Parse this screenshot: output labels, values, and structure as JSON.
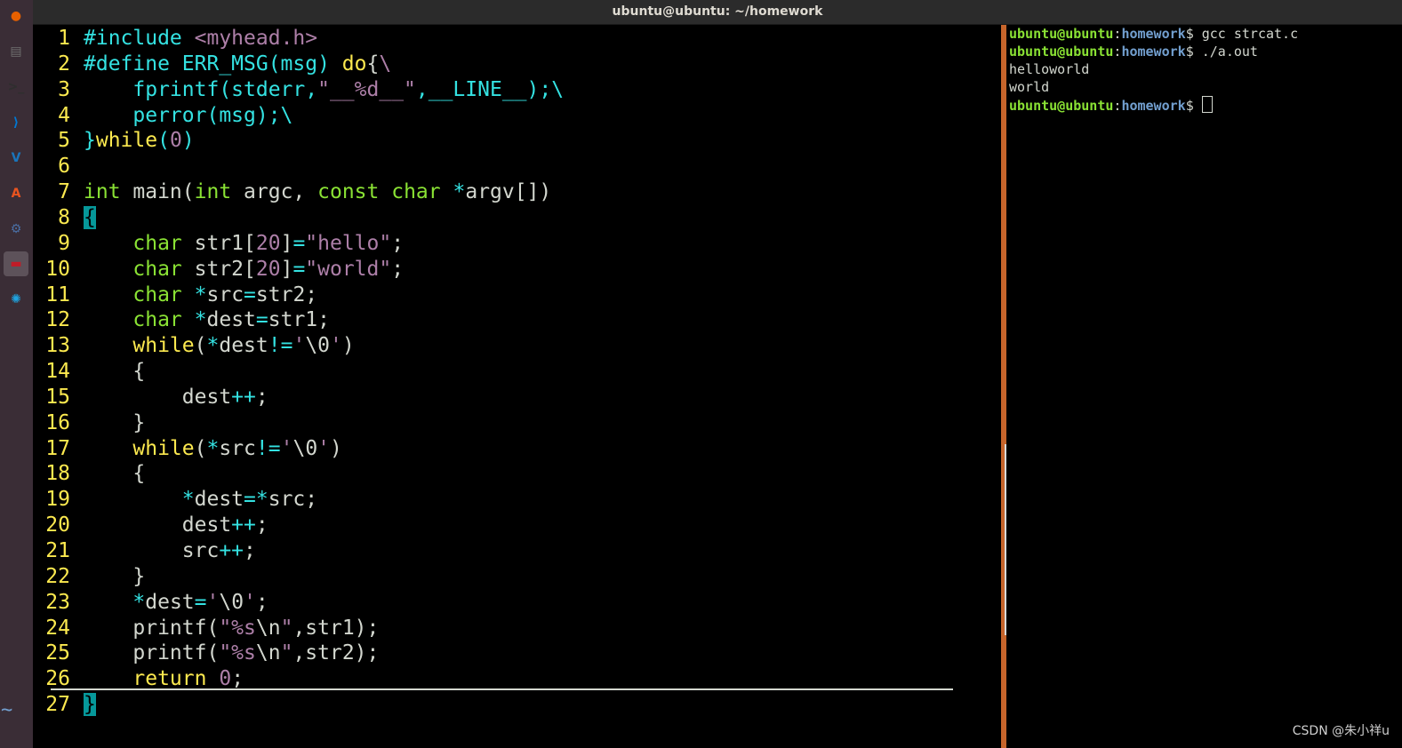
{
  "window": {
    "title": "ubuntu@ubuntu: ~/homework"
  },
  "launcher": {
    "items": [
      {
        "name": "firefox",
        "glyph": "●",
        "color": "#e66000"
      },
      {
        "name": "files",
        "glyph": "▤",
        "color": "#6f6f6f"
      },
      {
        "name": "terminal",
        "glyph": ">_",
        "color": "#2e2e2e"
      },
      {
        "name": "vscode",
        "glyph": "⟩",
        "color": "#0078d4"
      },
      {
        "name": "vmware",
        "glyph": "V",
        "color": "#1a75bb"
      },
      {
        "name": "software",
        "glyph": "A",
        "color": "#e95420"
      },
      {
        "name": "network",
        "glyph": "⚙",
        "color": "#4a6fa5"
      },
      {
        "name": "terminal-active",
        "glyph": "▬",
        "color": "#c01c28"
      },
      {
        "name": "settings",
        "glyph": "✺",
        "color": "#1fa3e0"
      }
    ]
  },
  "editor": {
    "lines": [
      {
        "n": "1",
        "html": "<span class='pp'>#include</span> <span class='str'>&lt;myhead.h&gt;</span>"
      },
      {
        "n": "2",
        "html": "<span class='pp'>#define ERR_MSG(msg) </span><span class='kw'>do</span>{<span class='str'>\\</span>"
      },
      {
        "n": "3",
        "html": "    <span class='pp'>fprintf(stderr,</span><span class='str'>\"__%d__\"</span><span class='pp'>,__LINE__);\\</span>"
      },
      {
        "n": "4",
        "html": "    <span class='pp'>perror(msg);\\</span>"
      },
      {
        "n": "5",
        "html": "<span class='pp'>}</span><span class='kw'>while</span><span class='pp'>(</span><span class='num'>0</span><span class='pp'>)</span>"
      },
      {
        "n": "6",
        "html": ""
      },
      {
        "n": "7",
        "html": "<span class='ty'>int</span> main(<span class='ty'>int</span> argc, <span class='ty'>const</span> <span class='ty'>char</span> <span class='op'>*</span>argv[])"
      },
      {
        "n": "8",
        "html": "<span class='cursor'>{</span>"
      },
      {
        "n": "9",
        "html": "    <span class='ty'>char</span> str1[<span class='num'>20</span>]<span class='op'>=</span><span class='str'>\"hello\"</span>;"
      },
      {
        "n": "10",
        "html": "    <span class='ty'>char</span> str2[<span class='num'>20</span>]<span class='op'>=</span><span class='str'>\"world\"</span>;"
      },
      {
        "n": "11",
        "html": "    <span class='ty'>char</span> <span class='op'>*</span>src<span class='op'>=</span>str2;"
      },
      {
        "n": "12",
        "html": "    <span class='ty'>char</span> <span class='op'>*</span>dest<span class='op'>=</span>str1;"
      },
      {
        "n": "13",
        "html": "    <span class='kw'>while</span>(<span class='op'>*</span>dest<span class='op'>!=</span><span class='str'>'</span>\\0<span class='str'>'</span>)"
      },
      {
        "n": "14",
        "html": "    {"
      },
      {
        "n": "15",
        "html": "        dest<span class='op'>++</span>;"
      },
      {
        "n": "16",
        "html": "    }"
      },
      {
        "n": "17",
        "html": "    <span class='kw'>while</span>(<span class='op'>*</span>src<span class='op'>!=</span><span class='str'>'</span>\\0<span class='str'>'</span>)"
      },
      {
        "n": "18",
        "html": "    {"
      },
      {
        "n": "19",
        "html": "        <span class='op'>*</span>dest<span class='op'>=*</span>src;"
      },
      {
        "n": "20",
        "html": "        dest<span class='op'>++</span>;"
      },
      {
        "n": "21",
        "html": "        src<span class='op'>++</span>;"
      },
      {
        "n": "22",
        "html": "    }"
      },
      {
        "n": "23",
        "html": "    <span class='op'>*</span>dest<span class='op'>=</span><span class='str'>'</span>\\0<span class='str'>'</span>;"
      },
      {
        "n": "24",
        "html": "    printf(<span class='str'>\"%s</span>\\n<span class='str'>\"</span>,str1);"
      },
      {
        "n": "25",
        "html": "    printf(<span class='str'>\"%s</span>\\n<span class='str'>\"</span>,str2);"
      },
      {
        "n": "26",
        "html": "    <span class='kw'>return</span> <span class='num'>0</span>;"
      },
      {
        "n": "27",
        "html": "<span class='cursor'>}</span>"
      }
    ],
    "tilde": "~"
  },
  "terminal": {
    "prompt_user": "ubuntu@ubuntu",
    "prompt_sep": ":",
    "prompt_path": "homework",
    "prompt_sign": "$ ",
    "lines": [
      {
        "type": "cmd",
        "text": "gcc strcat.c"
      },
      {
        "type": "cmd",
        "text": "./a.out"
      },
      {
        "type": "out",
        "text": "helloworld"
      },
      {
        "type": "out",
        "text": "world"
      },
      {
        "type": "prompt",
        "text": ""
      }
    ]
  },
  "watermark": "CSDN @朱小祥u"
}
